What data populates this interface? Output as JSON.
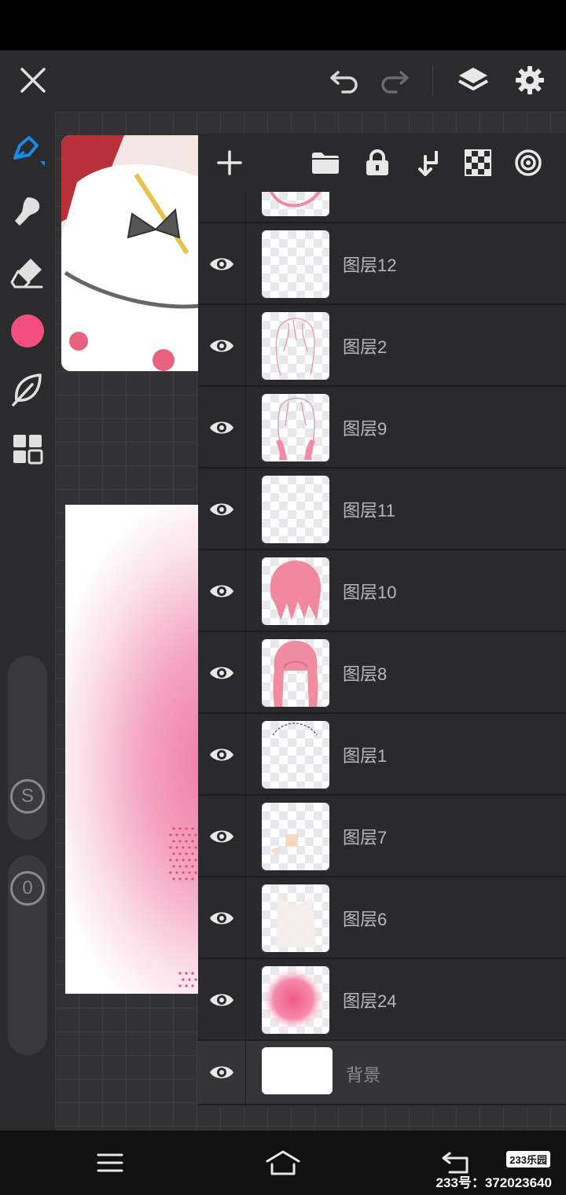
{
  "app": {
    "accent": "#1e88e5",
    "current_color": "#f24f7f"
  },
  "top_toolbar": {
    "icons": [
      "close-icon",
      "undo-icon",
      "redo-icon",
      "layers-icon",
      "settings-icon"
    ]
  },
  "left_toolbar": {
    "icons": [
      "brush-icon",
      "smudge-icon",
      "eraser-icon",
      "color-swatch",
      "leaf-icon",
      "grid-icon"
    ],
    "size_label": "S",
    "opacity_label": "0"
  },
  "layers_panel": {
    "toolbar_icons": [
      "add-icon",
      "folder-icon",
      "lock-icon",
      "merge-down-icon",
      "checker-icon",
      "target-icon"
    ],
    "layers": [
      {
        "name": "图层12",
        "thumb": "blank"
      },
      {
        "name": "图层2",
        "thumb": "sketch"
      },
      {
        "name": "图层9",
        "thumb": "sketch2"
      },
      {
        "name": "图层11",
        "thumb": "blank"
      },
      {
        "name": "图层10",
        "thumb": "hair"
      },
      {
        "name": "图层8",
        "thumb": "hair-long"
      },
      {
        "name": "图层1",
        "thumb": "arc"
      },
      {
        "name": "图层7",
        "thumb": "faint"
      },
      {
        "name": "图层6",
        "thumb": "faint2"
      },
      {
        "name": "图层24",
        "thumb": "blob"
      }
    ],
    "background_layer": "背景"
  },
  "nav_bar": {
    "icons": [
      "menu-icon",
      "home-icon",
      "back-icon"
    ],
    "watermark_logo": "233乐园",
    "watermark_text": "233号：372023640"
  }
}
